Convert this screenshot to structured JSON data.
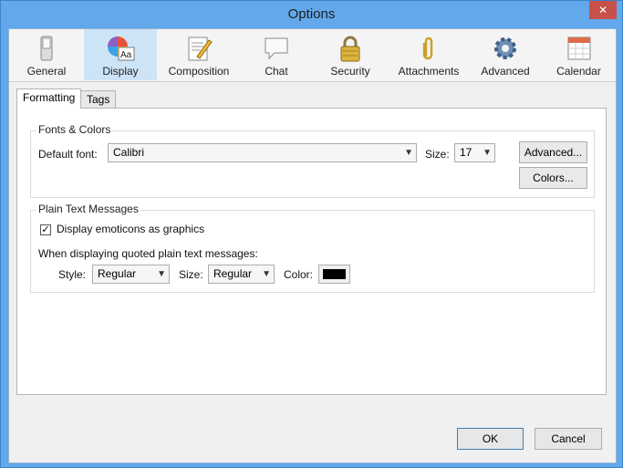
{
  "window": {
    "title": "Options",
    "close_glyph": "✕"
  },
  "toolbar": {
    "items": [
      {
        "label": "General",
        "icon": "toggle-switch-icon"
      },
      {
        "label": "Display",
        "icon": "palette-icon",
        "selected": true
      },
      {
        "label": "Composition",
        "icon": "document-pencil-icon"
      },
      {
        "label": "Chat",
        "icon": "speech-bubble-icon"
      },
      {
        "label": "Security",
        "icon": "padlock-icon"
      },
      {
        "label": "Attachments",
        "icon": "paperclip-icon"
      },
      {
        "label": "Advanced",
        "icon": "gear-icon"
      },
      {
        "label": "Calendar",
        "icon": "calendar-icon"
      }
    ]
  },
  "tabs": [
    {
      "label": "Formatting",
      "active": true
    },
    {
      "label": "Tags",
      "active": false
    }
  ],
  "fonts_colors": {
    "title": "Fonts & Colors",
    "default_font_label": "Default font:",
    "default_font_value": "Calibri",
    "size_label": "Size:",
    "size_value": "17",
    "advanced_button": "Advanced...",
    "colors_button": "Colors..."
  },
  "plain_text": {
    "title": "Plain Text Messages",
    "emoticons_label": "Display emoticons as graphics",
    "emoticons_checked": true,
    "quoted_label": "When displaying quoted plain text messages:",
    "style_label": "Style:",
    "style_value": "Regular",
    "size_label": "Size:",
    "size_value": "Regular",
    "color_label": "Color:",
    "color_value": "#000000"
  },
  "footer": {
    "ok": "OK",
    "cancel": "Cancel"
  },
  "colors": {
    "accent": "#62a8ea",
    "selected_tab": "#cde4f7"
  }
}
